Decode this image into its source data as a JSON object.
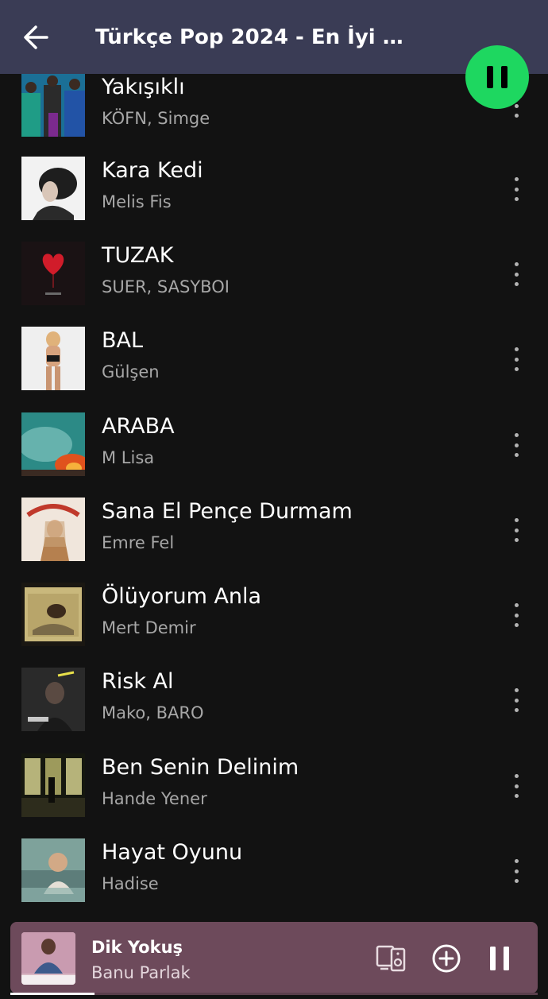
{
  "header": {
    "title": "Türkçe Pop 2024 - En İyi Tür...",
    "back_icon": "arrow-left-icon",
    "background": "#3a3c55"
  },
  "play_button": {
    "state": "pause-icon",
    "color": "#1ed760"
  },
  "tracks": [
    {
      "title": "Yakışıklı",
      "artist": "KÖFN, Simge"
    },
    {
      "title": "Kara Kedi",
      "artist": "Melis Fis"
    },
    {
      "title": "TUZAK",
      "artist": "SUER, SASYBOI"
    },
    {
      "title": "BAL",
      "artist": "Gülşen"
    },
    {
      "title": "ARABA",
      "artist": "M Lisa"
    },
    {
      "title": "Sana El Pençe Durmam",
      "artist": "Emre Fel"
    },
    {
      "title": "Ölüyorum Anla",
      "artist": "Mert Demir"
    },
    {
      "title": "Risk Al",
      "artist": "Mako, BARO"
    },
    {
      "title": "Ben Senin Delinim",
      "artist": "Hande Yener"
    },
    {
      "title": "Hayat Oyunu",
      "artist": "Hadise"
    }
  ],
  "now_playing": {
    "title": "Dik Yokuş",
    "artist": "Banu Parlak",
    "progress": 0.16,
    "background": "#6d4a5b",
    "icons": [
      "devices-icon",
      "add-icon",
      "pause-icon"
    ]
  }
}
